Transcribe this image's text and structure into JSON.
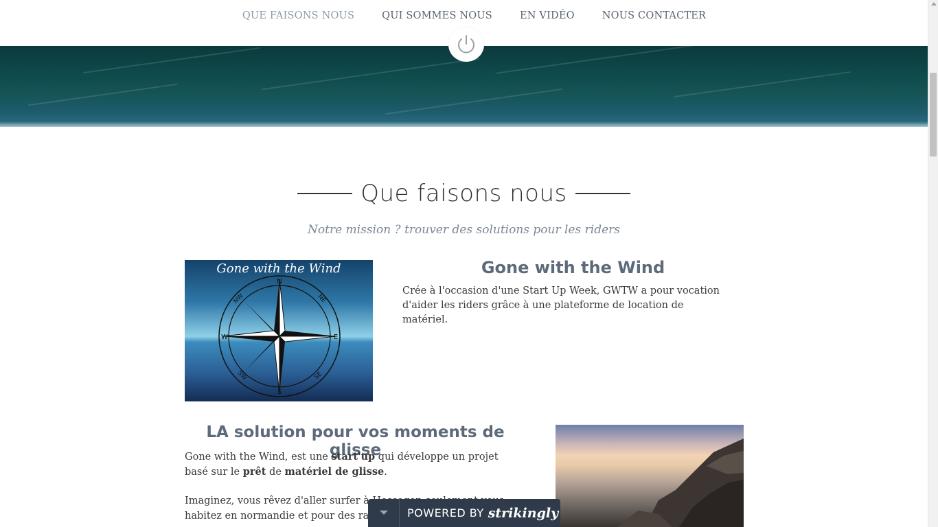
{
  "nav": {
    "items": [
      {
        "label": "QUE FAISONS NOUS",
        "active": true
      },
      {
        "label": "QUI SOMMES NOUS",
        "active": false
      },
      {
        "label": "EN VIDÉO",
        "active": false
      },
      {
        "label": "NOUS CONTACTER",
        "active": false
      }
    ]
  },
  "power_icon": "power-icon",
  "section": {
    "title": "Que faisons nous",
    "subtitle": "Notre mission ? trouver des solutions pour les riders"
  },
  "block1": {
    "image_caption": "Gone with the Wind",
    "compass_labels": [
      "N",
      "NE",
      "E",
      "SE",
      "S",
      "SW",
      "W",
      "NW"
    ],
    "title": "Gone with the Wind",
    "text": "Crée à l'occasion d'une Start Up Week, GWTW a pour vocation d'aider les riders grâce à une plateforme de location de matériel."
  },
  "block2": {
    "title": "LA solution pour vos moments de glisse",
    "p1_a": "Gone with the Wind, est une ",
    "p1_b": "start'up",
    "p1_c": " qui développe un projet basé sur le ",
    "p1_d": "prêt",
    "p1_e": " de ",
    "p1_f": "matériel de glisse",
    "p1_g": ".",
    "p2": "Imaginez, vous rêvez d'aller surfer à Hossegor, seulement vous habitez en normandie et pour des raisons"
  },
  "powered": {
    "label": "POWERED BY",
    "brand": "strikingly"
  },
  "colors": {
    "nav_active": "#8e9aa6",
    "nav_text": "#5a6470",
    "heading": "#5c6a7a",
    "powered_bg": "#2f3a4a"
  }
}
